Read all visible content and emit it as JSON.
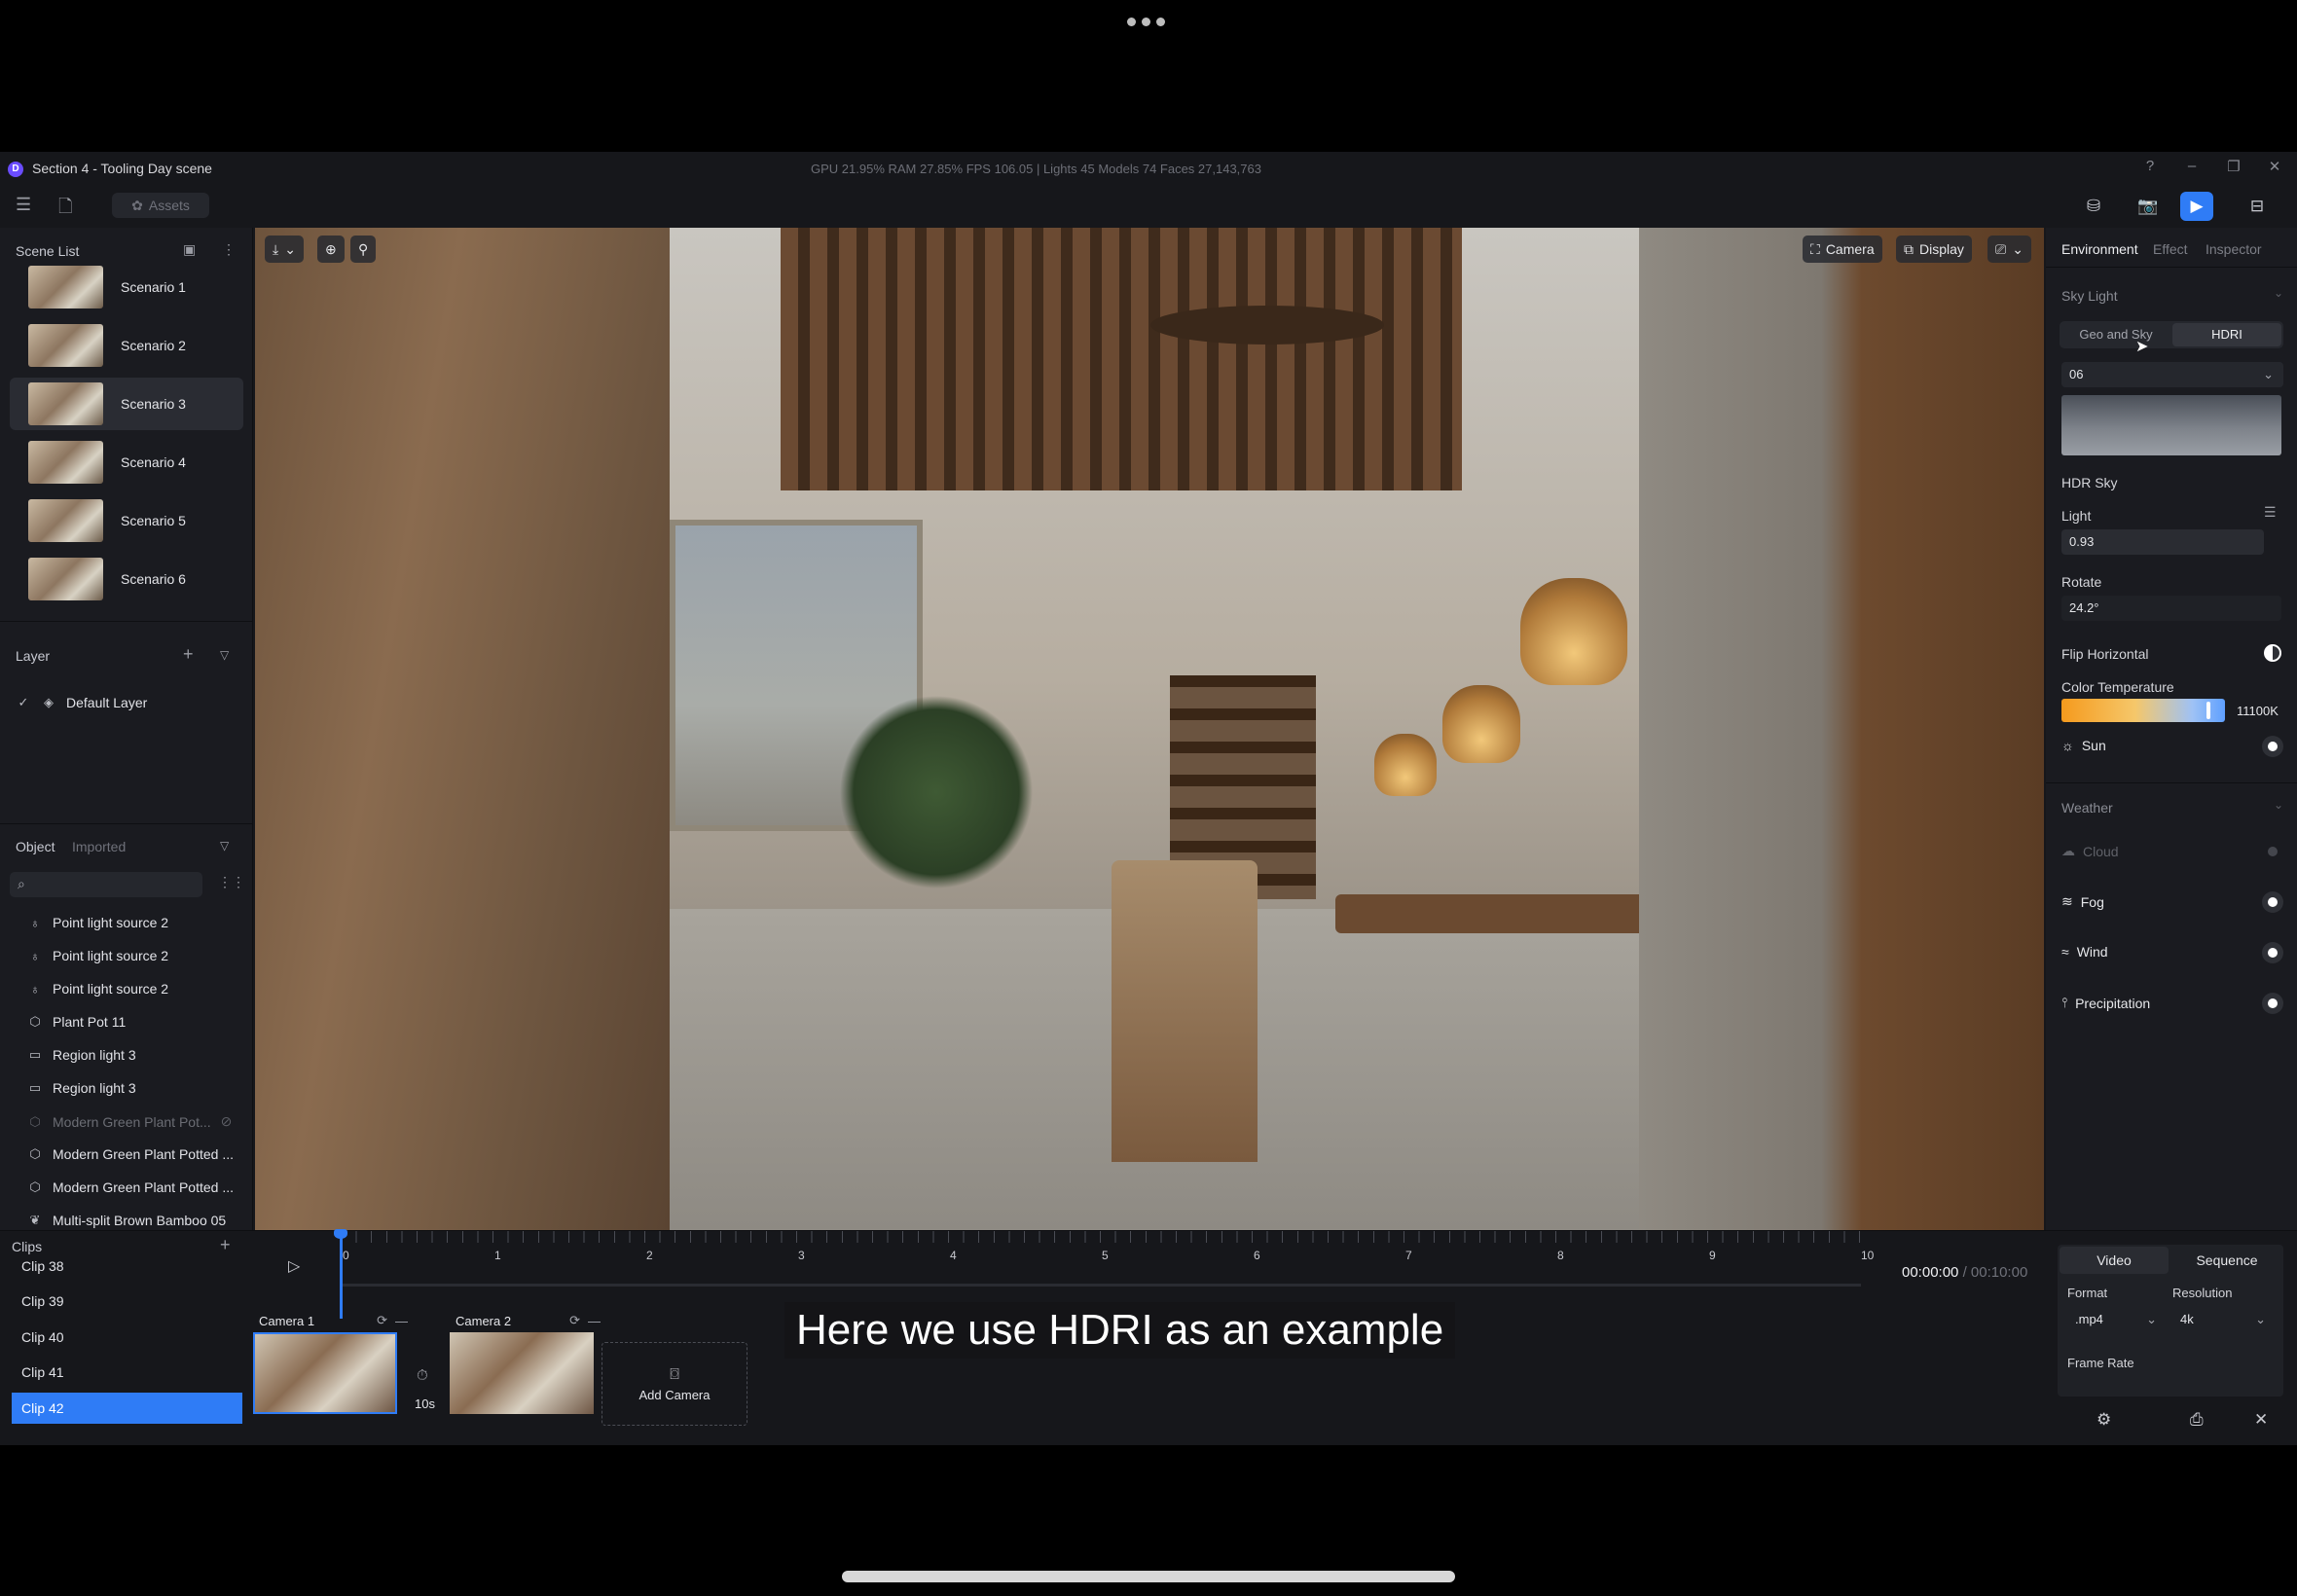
{
  "window": {
    "title": "Section 4 - Tooling Day scene",
    "stats": "GPU 21.95%   RAM 27.85%   FPS 106.05   |   Lights 45   Models 74   Faces 27,143,763"
  },
  "toolbar": {
    "assets_label": "Assets"
  },
  "scene_list": {
    "title": "Scene List",
    "items": [
      {
        "label": "Scenario 1"
      },
      {
        "label": "Scenario 2"
      },
      {
        "label": "Scenario 3"
      },
      {
        "label": "Scenario 4"
      },
      {
        "label": "Scenario 5"
      },
      {
        "label": "Scenario 6"
      }
    ],
    "selected_index": 2
  },
  "layer": {
    "title": "Layer",
    "items": [
      {
        "label": "Default Layer"
      }
    ]
  },
  "objects": {
    "tab_object": "Object",
    "tab_imported": "Imported",
    "search_placeholder": "",
    "items": [
      {
        "label": "Point light source 2",
        "icon": "bulb-icon"
      },
      {
        "label": "Point light source 2",
        "icon": "bulb-icon"
      },
      {
        "label": "Point light source 2",
        "icon": "bulb-icon"
      },
      {
        "label": "Plant Pot 11",
        "icon": "cube-icon"
      },
      {
        "label": "Region light 3",
        "icon": "rect-icon"
      },
      {
        "label": "Region light 3",
        "icon": "rect-icon"
      },
      {
        "label": "Modern Green Plant Pot...",
        "icon": "cube-icon"
      },
      {
        "label": "Modern Green Plant Potted ...",
        "icon": "cube-icon"
      },
      {
        "label": "Modern Green Plant Potted ...",
        "icon": "cube-icon"
      },
      {
        "label": "Multi-split Brown Bamboo 05",
        "icon": "leaf-icon"
      }
    ]
  },
  "viewport": {
    "camera_label": "Camera",
    "display_label": "Display"
  },
  "right_panel": {
    "tabs": [
      "Environment",
      "Effect",
      "Inspector"
    ],
    "sky_light": "Sky Light",
    "seg_geo": "Geo and Sky",
    "seg_hdri": "HDRI",
    "hdri_select": "06",
    "hdr_sky": "HDR Sky",
    "light_label": "Light",
    "light_value": "0.93",
    "rotate_label": "Rotate",
    "rotate_value": "24.2°",
    "flip_label": "Flip Horizontal",
    "color_temp_label": "Color Temperature",
    "color_temp_value": "11100K",
    "color_temp_fraction": 0.9,
    "sun_label": "Sun",
    "weather": "Weather",
    "cloud": "Cloud",
    "fog": "Fog",
    "wind": "Wind",
    "precipitation": "Precipitation"
  },
  "timeline": {
    "clips_title": "Clips",
    "clips": [
      {
        "label": "Clip 38"
      },
      {
        "label": "Clip 39"
      },
      {
        "label": "Clip 40"
      },
      {
        "label": "Clip 41"
      },
      {
        "label": "Clip 42"
      }
    ],
    "ruler": [
      "0",
      "1",
      "2",
      "3",
      "4",
      "5",
      "6",
      "7",
      "8",
      "9",
      "10"
    ],
    "time_current": "00:00:00",
    "time_total": "/ 00:10:00",
    "camera1": "Camera 1",
    "camera2": "Camera 2",
    "duration": "10s",
    "add_camera": "Add Camera",
    "subtitle": "Here we use HDRI as an example"
  },
  "video_panel": {
    "tab_video": "Video",
    "tab_sequence": "Sequence",
    "format_label": "Format",
    "format_value": ".mp4",
    "resolution_label": "Resolution",
    "resolution_value": "4k",
    "frame_rate_label": "Frame Rate"
  },
  "colors": {
    "accent": "#2f7cf6",
    "panel": "#1a1b20",
    "bg": "#16171b"
  }
}
